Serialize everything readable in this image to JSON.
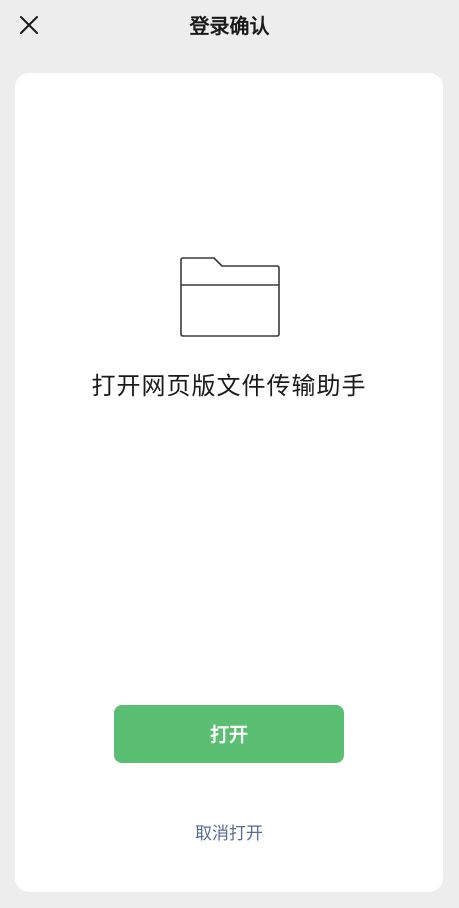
{
  "header": {
    "title": "登录确认",
    "close_icon": "close-icon"
  },
  "card": {
    "icon": "folder-icon",
    "headline": "打开网页版文件传输助手",
    "open_label": "打开",
    "cancel_label": "取消打开"
  },
  "colors": {
    "background": "#ededed",
    "card": "#ffffff",
    "primary_button": "#5bbf73",
    "link": "#576b95"
  }
}
